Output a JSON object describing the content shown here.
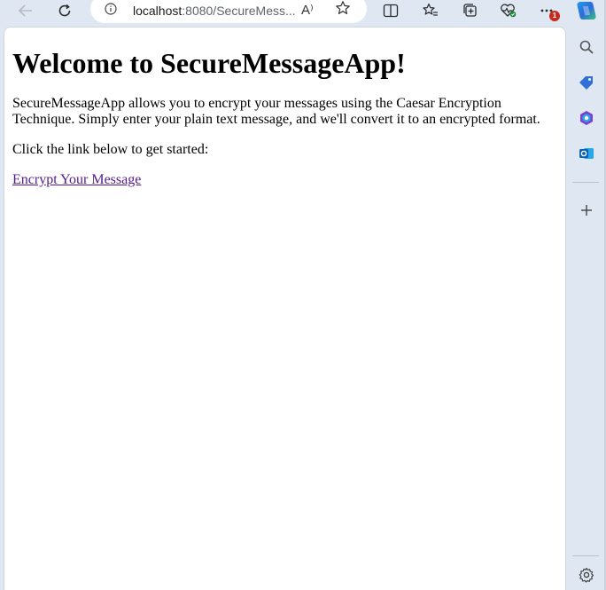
{
  "browser": {
    "url_host": "localhost",
    "url_path": ":8080/SecureMess...",
    "read_aloud_glyph": "A⁾",
    "notification_count": "1",
    "icons": [
      "back-arrow-icon",
      "refresh-icon",
      "info-icon",
      "read-aloud-icon",
      "favorite-star-icon",
      "split-screen-icon",
      "favorites-icon",
      "collections-icon",
      "browser-essentials-icon",
      "more-options-icon",
      "copilot-icon"
    ],
    "sidebar_icons": [
      "search-icon",
      "shopping-tag-icon",
      "office-icon",
      "outlook-icon",
      "add-icon",
      "settings-icon"
    ]
  },
  "page": {
    "heading": "Welcome to SecureMessageApp!",
    "intro": "SecureMessageApp allows you to encrypt your messages using the Caesar Encryption Technique. Simply enter your plain text message, and we'll convert it to an encrypted format.",
    "cta_text": "Click the link below to get started:",
    "link_text": "Encrypt Your Message"
  },
  "colors": {
    "chrome_bg": "#dfe7f2",
    "link_visited": "#551a8b",
    "badge_red": "#c42b1c"
  }
}
